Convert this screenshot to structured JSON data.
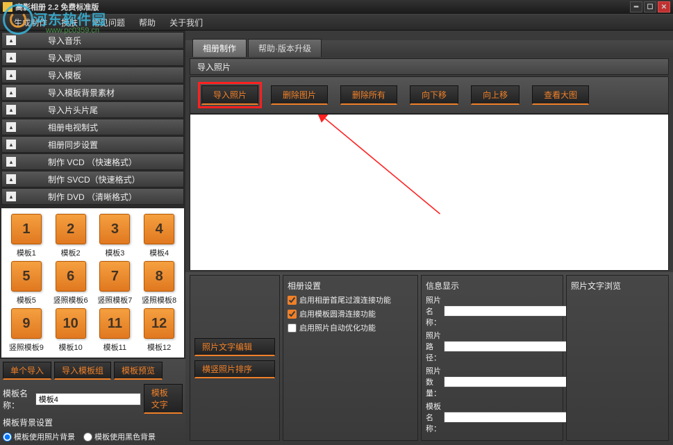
{
  "title": "高影相册 2.2 免费标准版",
  "watermark": {
    "text": "河东软件园",
    "url": "www.pc0359.cn"
  },
  "menu": [
    "生成制作",
    "换肤",
    "常见问题",
    "帮助",
    "关于我们"
  ],
  "sidebar": [
    "导入音乐",
    "导入歌词",
    "导入模板",
    "导入模板背景素材",
    "导入片头片尾",
    "相册电视制式",
    "相册同步设置",
    "制作 VCD （快速格式）",
    "制作 SVCD（快速格式）",
    "制作 DVD （清晰格式）"
  ],
  "templates": [
    {
      "n": "1",
      "name": "模板1"
    },
    {
      "n": "2",
      "name": "模板2"
    },
    {
      "n": "3",
      "name": "模板3"
    },
    {
      "n": "4",
      "name": "模板4"
    },
    {
      "n": "5",
      "name": "模板5"
    },
    {
      "n": "6",
      "name": "竖照模板6"
    },
    {
      "n": "7",
      "name": "竖照模板7"
    },
    {
      "n": "8",
      "name": "竖照模板8"
    },
    {
      "n": "9",
      "name": "竖照模板9"
    },
    {
      "n": "10",
      "name": "模板10"
    },
    {
      "n": "11",
      "name": "模板11"
    },
    {
      "n": "12",
      "name": "模板12"
    }
  ],
  "leftBtns": {
    "single": "单个导入",
    "group": "导入模板组",
    "preview": "模板预览",
    "text": "模板文字"
  },
  "tplNameLabel": "模板名称：",
  "tplNameValue": "模板4",
  "bgTitle": "模板背景设置",
  "bgRadios": [
    "模板使用照片背景",
    "模板使用黑色背景"
  ],
  "tabs": {
    "main": "相册制作",
    "help": "帮助·版本升级"
  },
  "subheader": "导入照片",
  "toolbar": [
    "导入照片",
    "删除图片",
    "删除所有",
    "向下移",
    "向上移",
    "查看大图"
  ],
  "panels": {
    "a": {
      "b1": "照片文字编辑",
      "b2": "横竖照片排序"
    },
    "b": {
      "title": "相册设置",
      "c1": "启用相册首尾过渡连接功能",
      "c2": "启用模板圆滑连接功能",
      "c3": "启用照片自动优化功能"
    },
    "c": {
      "title": "信息显示",
      "r1": "照片名称：",
      "r2": "照片路径：",
      "r3": "照片数量：",
      "r4": "模板名称："
    },
    "d": {
      "title": "照片文字浏览"
    }
  }
}
